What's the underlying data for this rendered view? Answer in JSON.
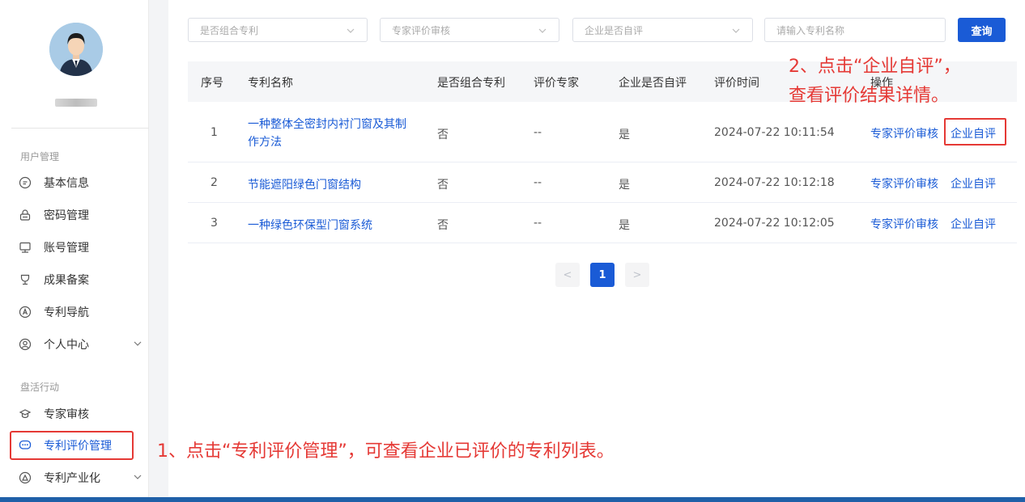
{
  "colors": {
    "accent": "#1a5bd6",
    "annotation": "#e53935",
    "bottom_bar": "#1f60a8"
  },
  "sidebar": {
    "groups": [
      {
        "title": "用户管理",
        "items": [
          {
            "label": "基本信息",
            "icon": "document-icon"
          },
          {
            "label": "密码管理",
            "icon": "lock-icon"
          },
          {
            "label": "账号管理",
            "icon": "monitor-icon"
          },
          {
            "label": "成果备案",
            "icon": "trophy-icon"
          },
          {
            "label": "专利导航",
            "icon": "compass-icon"
          },
          {
            "label": "个人中心",
            "icon": "user-circle-icon",
            "expandable": true
          }
        ]
      },
      {
        "title": "盘活行动",
        "items": [
          {
            "label": "专家审核",
            "icon": "shield-icon"
          },
          {
            "label": "专利评价管理",
            "icon": "chat-icon",
            "active": true
          },
          {
            "label": "专利产业化",
            "icon": "chart-icon",
            "expandable": true
          }
        ]
      }
    ]
  },
  "filters": {
    "combo": "是否组合专利",
    "expert": "专家评价审核",
    "self": "企业是否自评",
    "search_placeholder": "请输入专利名称",
    "query_label": "查询"
  },
  "table": {
    "headers": [
      "序号",
      "专利名称",
      "是否组合专利",
      "评价专家",
      "企业是否自评",
      "评价时间",
      "操作"
    ],
    "rows": [
      {
        "index": "1",
        "name_line1": "一种整体全密封内衬门窗及其制",
        "name_line2": "作方法",
        "combo": "否",
        "expert": "--",
        "self": "是",
        "time": "2024-07-22 10:11:54",
        "op1": "专家评价审核",
        "op2": "企业自评"
      },
      {
        "index": "2",
        "name_line1": "节能遮阳绿色门窗结构",
        "name_line2": "",
        "combo": "否",
        "expert": "--",
        "self": "是",
        "time": "2024-07-22 10:12:18",
        "op1": "专家评价审核",
        "op2": "企业自评"
      },
      {
        "index": "3",
        "name_line1": "一种绿色环保型门窗系统",
        "name_line2": "",
        "combo": "否",
        "expert": "--",
        "self": "是",
        "time": "2024-07-22 10:12:05",
        "op1": "专家评价审核",
        "op2": "企业自评"
      }
    ]
  },
  "pagination": {
    "prev": "<",
    "current": "1",
    "next": ">"
  },
  "annotations": {
    "step1": "1、点击“专利评价管理”，可查看企业已评价的专利列表。",
    "step2_line1": "2、点击“企业自评”，",
    "step2_line2": "查看评价结果详情。"
  }
}
